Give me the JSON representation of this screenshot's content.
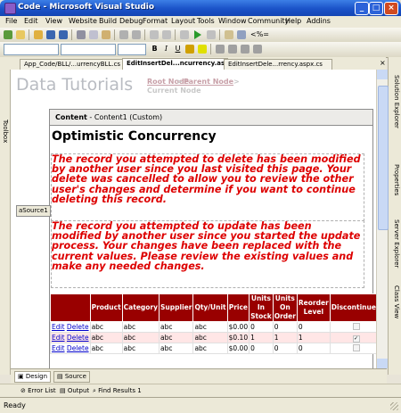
{
  "window": {
    "title": "Code - Microsoft Visual Studio",
    "buttons": {
      "min": "_",
      "max": "□",
      "close": "×"
    }
  },
  "menu": [
    "File",
    "Edit",
    "View",
    "Website",
    "Build",
    "Debug",
    "Format",
    "Layout",
    "Tools",
    "Window",
    "Community",
    "Help",
    "Addins"
  ],
  "toolbar": {
    "run_target": "<%=",
    "bold": "B",
    "italic": "I",
    "underline": "U",
    "icons": [
      "new-project-icon",
      "open-file-icon",
      "save-icon",
      "save-all-icon",
      "cut-icon",
      "copy-icon",
      "paste-icon",
      "undo-icon",
      "redo-icon",
      "start-debug-icon",
      "find-icon",
      "align-left-icon",
      "align-center-icon",
      "align-right-icon",
      "list-icon"
    ]
  },
  "doc_tabs": [
    "App_Code/BLL/...urrencyBLL.cs",
    "EditInsertDel...ncurrency.aspx",
    "EditInsertDele...rrency.aspx.cs"
  ],
  "side_tabs": {
    "left": [
      "Toolbox"
    ],
    "right": [
      "Solution Explorer",
      "Properties",
      "Server Explorer",
      "Class View"
    ]
  },
  "designer": {
    "site_title": "Data Tutorials",
    "breadcrumb": {
      "root": "Root Node",
      "sep": ">",
      "parent": "Parent Node",
      "current": "Current Node"
    },
    "content_label_bold": "Content",
    "content_label_rest": "- Content1 (Custom)",
    "heading": "Optimistic Concurrency",
    "delete_message": "The record you attempted to delete has been modified by another user since you last visited this page. Your delete was cancelled to allow you to review the other user's changes and determine if you want to continue deleting this record.",
    "update_message": "The record you attempted to update has been modified by another user since you started the update process. Your changes have been replaced with the current values. Please review the existing values and make any needed changes.",
    "datasource_tag": "aSource1"
  },
  "grid": {
    "headers": [
      "",
      "Product",
      "Category",
      "Supplier",
      "Qty/Unit",
      "Price",
      "Units In Stock",
      "Units On Order",
      "Reorder Level",
      "Discontinued"
    ],
    "rows": [
      {
        "edit": "Edit",
        "delete": "Delete",
        "product": "abc",
        "category": "abc",
        "supplier": "abc",
        "qty": "abc",
        "price": "$0.00",
        "stock": "0",
        "order": "0",
        "reorder": "0",
        "discontinued": false
      },
      {
        "edit": "Edit",
        "delete": "Delete",
        "product": "abc",
        "category": "abc",
        "supplier": "abc",
        "qty": "abc",
        "price": "$0.10",
        "stock": "1",
        "order": "1",
        "reorder": "1",
        "discontinued": true
      },
      {
        "edit": "Edit",
        "delete": "Delete",
        "product": "abc",
        "category": "abc",
        "supplier": "abc",
        "qty": "abc",
        "price": "$0.00",
        "stock": "0",
        "order": "0",
        "reorder": "0",
        "discontinued": false
      }
    ]
  },
  "view_tabs": {
    "design": "Design",
    "source": "Source"
  },
  "tool_windows": [
    "Error List",
    "Output",
    "Find Results 1"
  ],
  "status": "Ready"
}
